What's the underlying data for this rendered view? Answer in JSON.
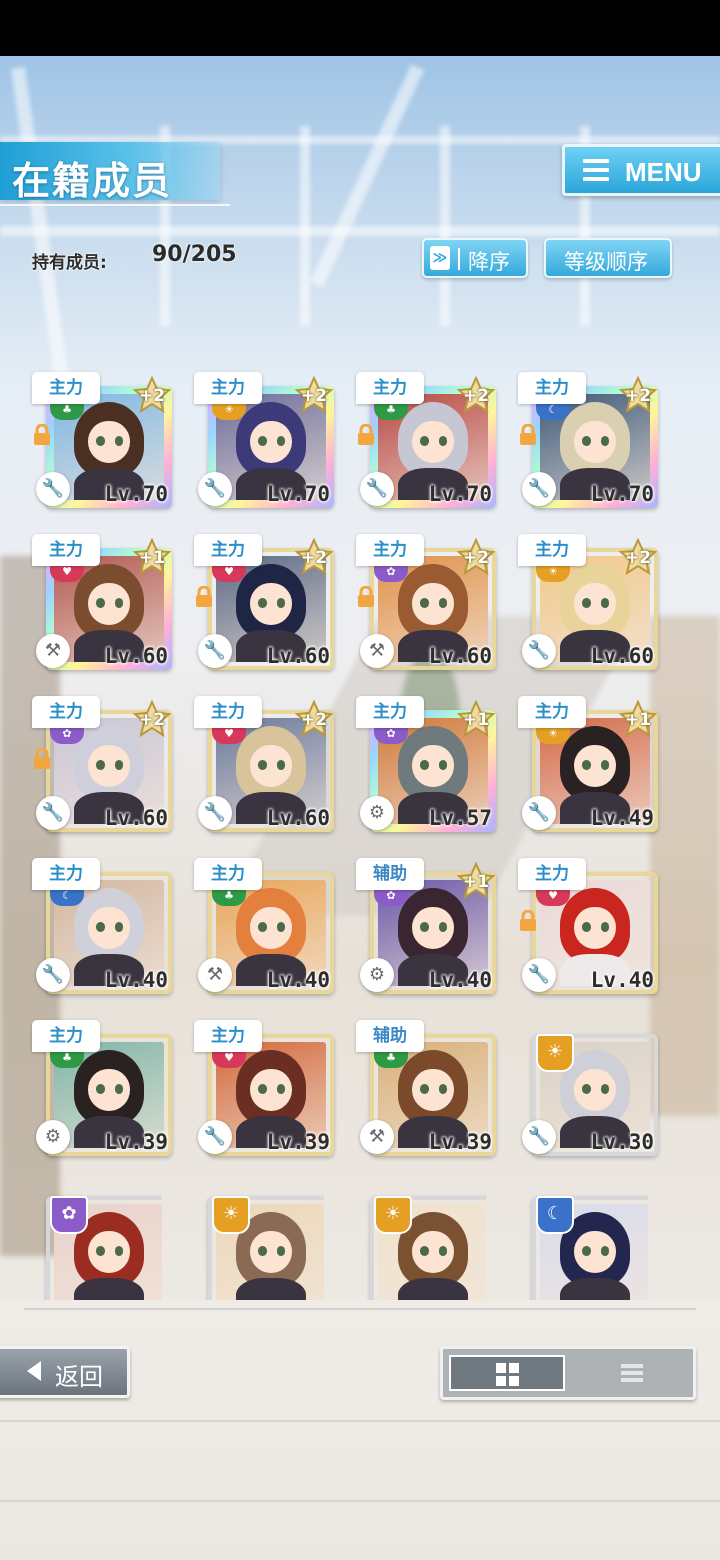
{
  "header": {
    "title": "在籍成员",
    "menu_label": "MENU"
  },
  "owned": {
    "label": "持有成员:",
    "value": "90/205"
  },
  "sort": {
    "order_icon": "≫",
    "order_label": "降序",
    "key_label": "等级顺序"
  },
  "colors": {
    "accent": "#2aa6da",
    "attr_red": "#d8395b",
    "attr_green": "#2f9a45",
    "attr_blue": "#3a72c9",
    "attr_purple": "#8a5bc9",
    "attr_orange": "#e5a024"
  },
  "cards": [
    {
      "role": "主力",
      "attr": "green",
      "plus": "+2",
      "lock": true,
      "tool": "wrench-icon",
      "level": "Lv.70",
      "rainbow": true,
      "hair": "#4a2f22",
      "bg": "#7fb8e3"
    },
    {
      "role": "主力",
      "attr": "orange",
      "plus": "+2",
      "lock": false,
      "tool": "wrench-icon",
      "level": "Lv.70",
      "rainbow": true,
      "hair": "#3d3a7a",
      "bg": "#6e6e9c"
    },
    {
      "role": "主力",
      "attr": "green",
      "plus": "+2",
      "lock": true,
      "tool": "wrench-icon",
      "level": "Lv.70",
      "rainbow": true,
      "hair": "#c7c7d4",
      "bg": "#b84a45"
    },
    {
      "role": "主力",
      "attr": "blue",
      "plus": "+2",
      "lock": true,
      "tool": "wrench-icon",
      "level": "Lv.70",
      "rainbow": true,
      "hair": "#d8d0b0",
      "bg": "#3f5a7a"
    },
    {
      "role": "主力",
      "attr": "red",
      "plus": "+1",
      "lock": false,
      "tool": "hammer-icon",
      "level": "Lv.60",
      "rainbow": true,
      "hair": "#7b4c2e",
      "bg": "#b25a52"
    },
    {
      "role": "主力",
      "attr": "red",
      "plus": "+2",
      "lock": true,
      "tool": "wrench-icon",
      "level": "Lv.60",
      "rainbow": false,
      "hair": "#1f2545",
      "bg": "#5c6a86"
    },
    {
      "role": "主力",
      "attr": "purple",
      "plus": "+2",
      "lock": true,
      "tool": "hammer-icon",
      "level": "Lv.60",
      "rainbow": false,
      "hair": "#9a5a32",
      "bg": "#e0924a"
    },
    {
      "role": "主力",
      "attr": "orange",
      "plus": "+2",
      "lock": false,
      "tool": "wrench-icon",
      "level": "Lv.60",
      "rainbow": false,
      "hair": "#e8d49a",
      "bg": "#f2c98a"
    },
    {
      "role": "主力",
      "attr": "purple",
      "plus": "+2",
      "lock": true,
      "tool": "wrench-icon",
      "level": "Lv.60",
      "rainbow": false,
      "hair": "#cfcfdc",
      "bg": "#c9c6d6"
    },
    {
      "role": "主力",
      "attr": "red",
      "plus": "+2",
      "lock": false,
      "tool": "wrench-icon",
      "level": "Lv.60",
      "rainbow": false,
      "hair": "#d8c49a",
      "bg": "#6b7a9c"
    },
    {
      "role": "主力",
      "attr": "purple",
      "plus": "+1",
      "lock": false,
      "tool": "gear-icon",
      "level": "Lv.57",
      "rainbow": true,
      "hair": "#6f7a7c",
      "bg": "#d07a3a"
    },
    {
      "role": "主力",
      "attr": "orange",
      "plus": "+1",
      "lock": false,
      "tool": "wrench-icon",
      "level": "Lv.49",
      "rainbow": false,
      "hair": "#2a2222",
      "bg": "#d46a4a"
    },
    {
      "role": "主力",
      "attr": "blue",
      "plus": "",
      "lock": false,
      "tool": "wrench-icon",
      "level": "Lv.40",
      "rainbow": false,
      "hair": "#d0d0da",
      "bg": "#d2b8a2"
    },
    {
      "role": "主力",
      "attr": "green",
      "plus": "",
      "lock": false,
      "tool": "hammer-icon",
      "level": "Lv.40",
      "rainbow": false,
      "hair": "#e4803e",
      "bg": "#e8a65a"
    },
    {
      "role": "辅助",
      "attr": "purple",
      "plus": "+1",
      "lock": false,
      "tool": "gear-icon",
      "level": "Lv.40",
      "rainbow": false,
      "hair": "#3a2630",
      "bg": "#6a5aa8"
    },
    {
      "role": "主力",
      "attr": "red",
      "plus": "",
      "lock": true,
      "tool": "wrench-icon",
      "level": "Lv.40",
      "rainbow": false,
      "hair": "#c8261e",
      "bg": "#e9dad8"
    },
    {
      "role": "主力",
      "attr": "green",
      "plus": "",
      "lock": false,
      "tool": "gear-icon",
      "level": "Lv.39",
      "rainbow": false,
      "hair": "#2a2220",
      "bg": "#7fb6a8"
    },
    {
      "role": "主力",
      "attr": "red",
      "plus": "",
      "lock": false,
      "tool": "wrench-icon",
      "level": "Lv.39",
      "rainbow": false,
      "hair": "#6b2e22",
      "bg": "#d26a3c"
    },
    {
      "role": "辅助",
      "attr": "green",
      "plus": "",
      "lock": false,
      "tool": "hammer-icon",
      "level": "Lv.39",
      "rainbow": false,
      "hair": "#7a4a2a",
      "bg": "#d8b07a"
    },
    {
      "role": "",
      "attr": "orange",
      "plus": "",
      "lock": false,
      "tool": "wrench-icon",
      "level": "Lv.30",
      "rainbow": false,
      "hair": "#cfcfd8",
      "bg": "#d9d2c8"
    },
    {
      "role": "",
      "attr": "purple",
      "plus": "",
      "lock": false,
      "tool": "",
      "level": "",
      "rainbow": false,
      "hair": "#9a2c22",
      "bg": "#e9d2cc"
    },
    {
      "role": "",
      "attr": "orange",
      "plus": "",
      "lock": false,
      "tool": "",
      "level": "",
      "rainbow": false,
      "hair": "#8a6a52",
      "bg": "#ecd8b8"
    },
    {
      "role": "",
      "attr": "orange",
      "plus": "",
      "lock": false,
      "tool": "",
      "level": "",
      "rainbow": false,
      "hair": "#7a5232",
      "bg": "#efe2cc"
    },
    {
      "role": "",
      "attr": "blue",
      "plus": "",
      "lock": false,
      "tool": "",
      "level": "",
      "rainbow": false,
      "hair": "#23264e",
      "bg": "#d8dcec"
    }
  ],
  "footer": {
    "back_label": "返回"
  }
}
